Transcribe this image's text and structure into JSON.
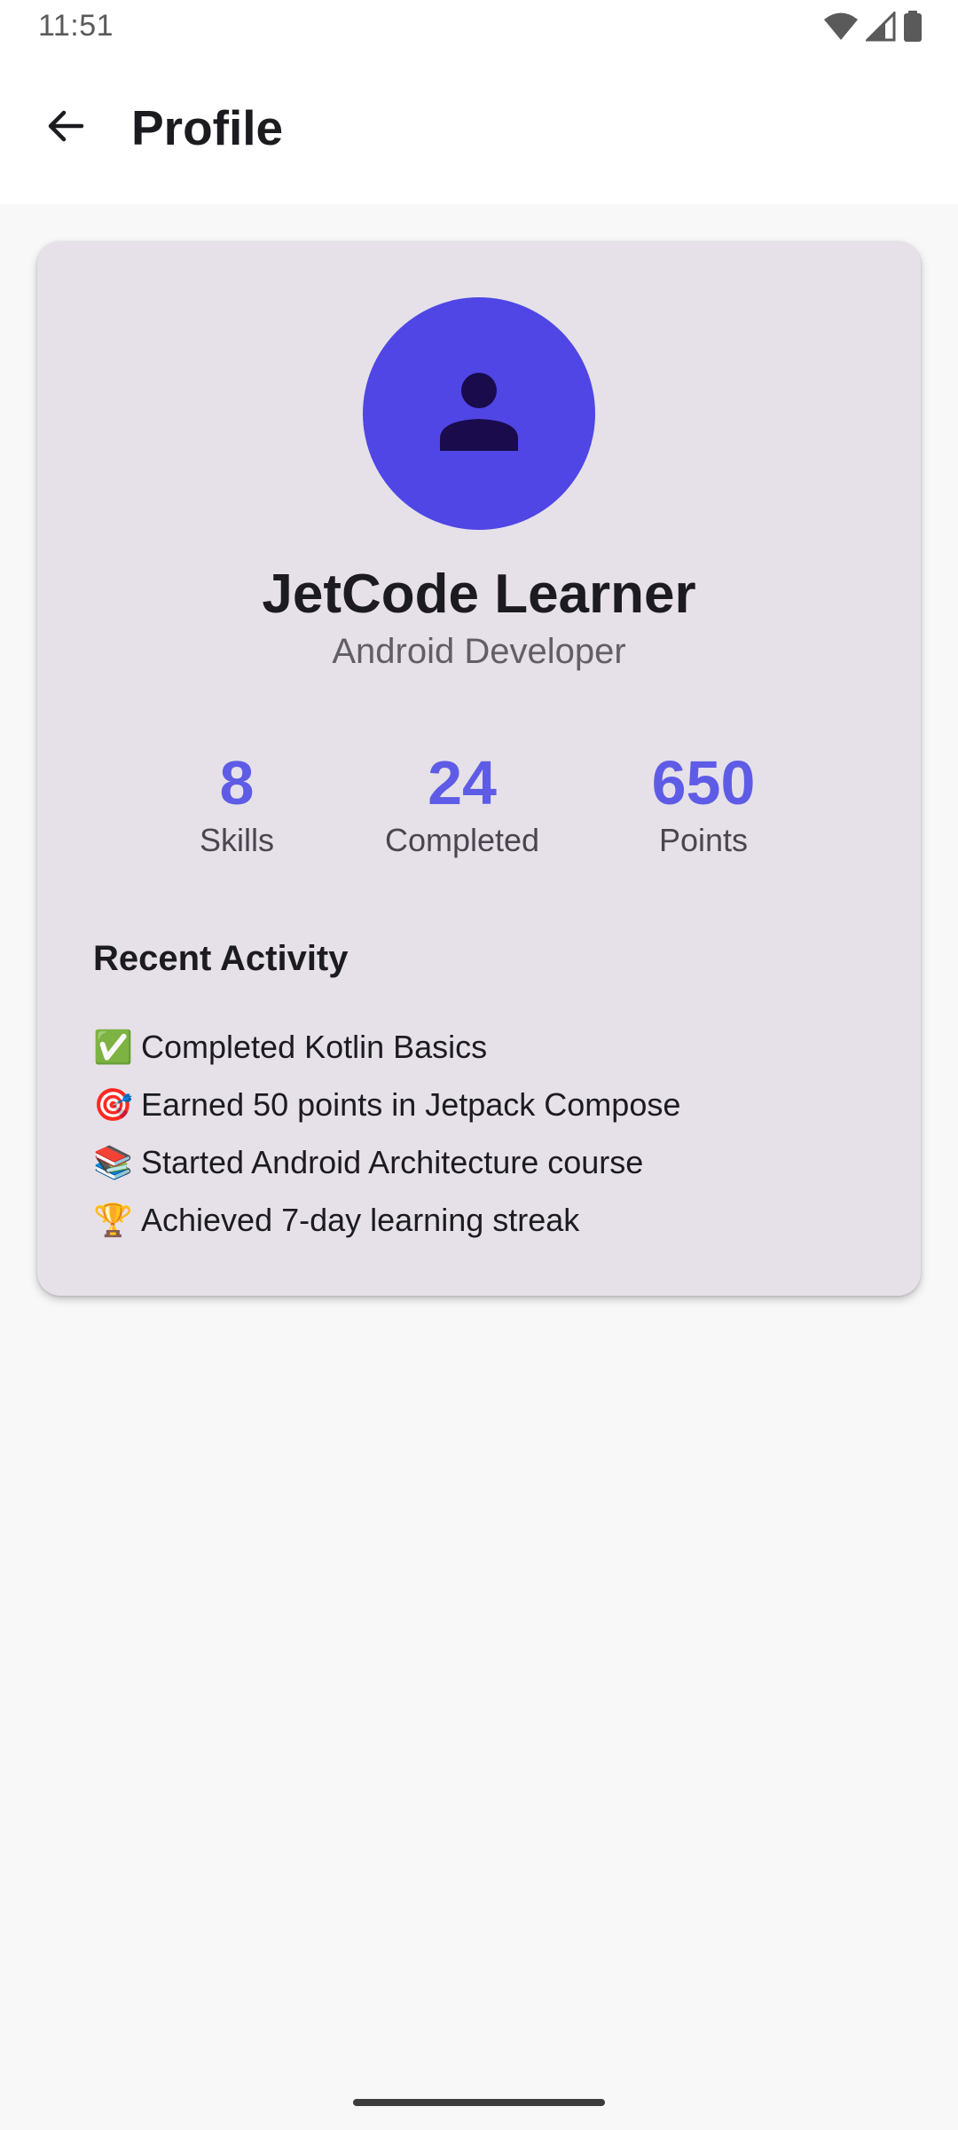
{
  "status_bar": {
    "time": "11:51",
    "icons": [
      "wifi-icon",
      "signal-icon",
      "battery-icon"
    ]
  },
  "app_bar": {
    "title": "Profile",
    "back_icon": "arrow-back-icon"
  },
  "profile": {
    "avatar_icon": "person-icon",
    "name": "JetCode Learner",
    "role": "Android Developer"
  },
  "stats": [
    {
      "value": "8",
      "label": "Skills"
    },
    {
      "value": "24",
      "label": "Completed"
    },
    {
      "value": "650",
      "label": "Points"
    }
  ],
  "recent_activity": {
    "title": "Recent Activity",
    "items": [
      {
        "emoji": "✅",
        "text": "Completed Kotlin Basics"
      },
      {
        "emoji": "🎯",
        "text": "Earned 50 points in Jetpack Compose"
      },
      {
        "emoji": "📚",
        "text": "Started Android Architecture course"
      },
      {
        "emoji": "🏆",
        "text": "Achieved 7-day learning streak"
      }
    ]
  },
  "colors": {
    "accent": "#5E5CE6",
    "avatar_bg": "#4F46E5",
    "card_bg": "#E6E1E8",
    "page_bg": "#F8F8F9"
  }
}
